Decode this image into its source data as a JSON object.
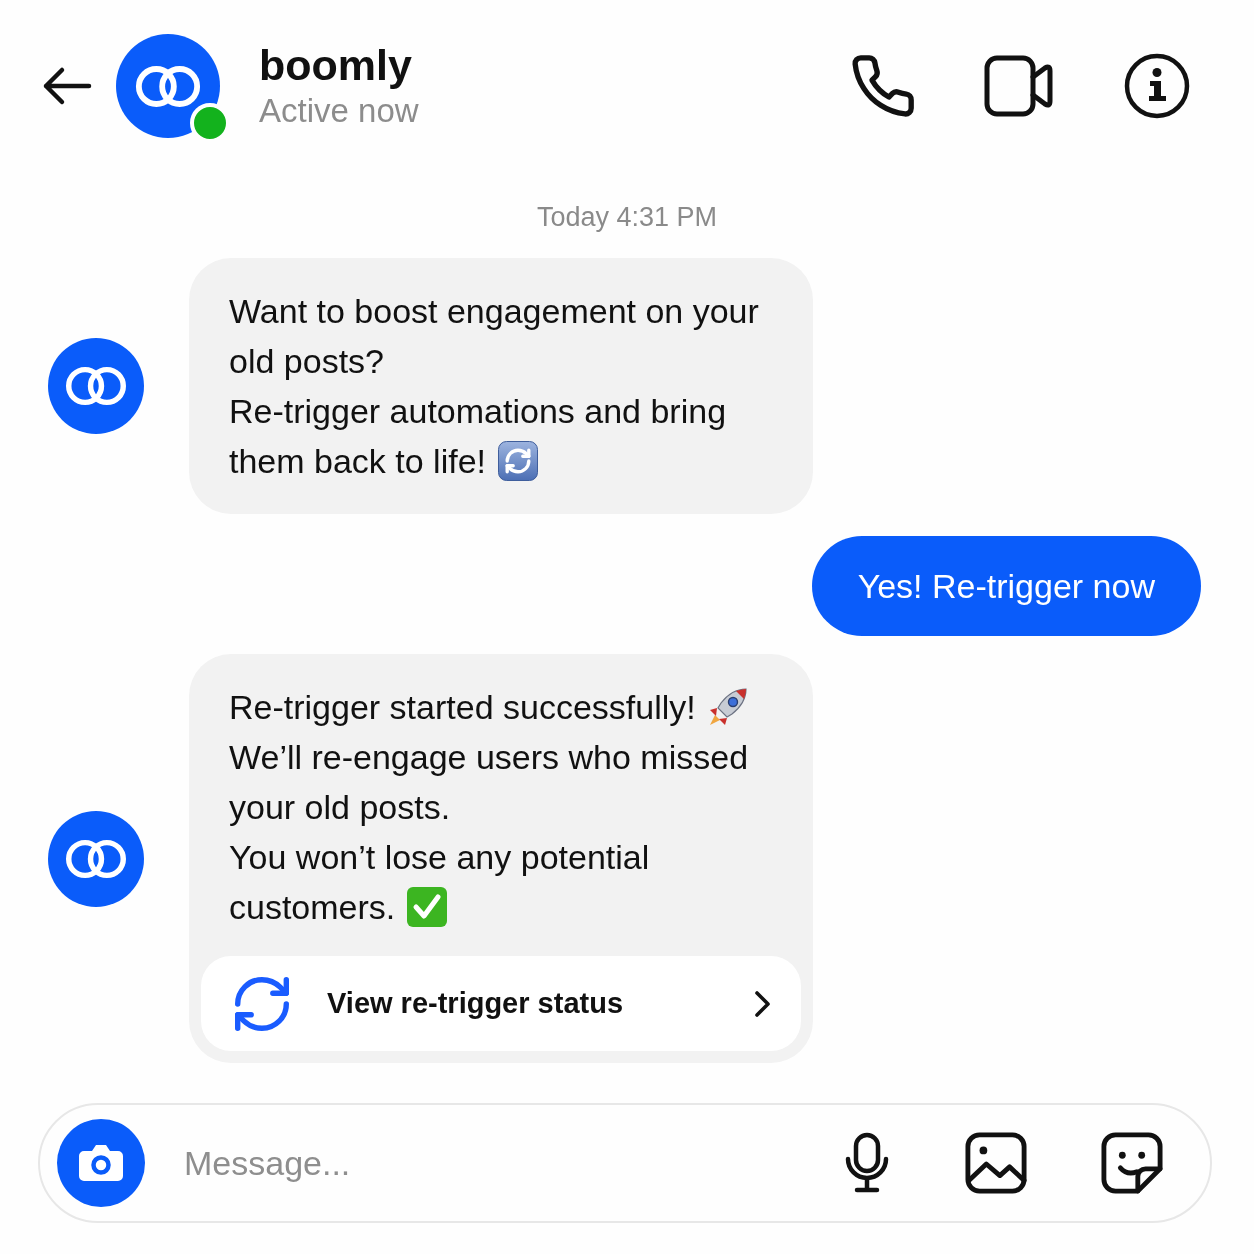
{
  "header": {
    "title": "boomly",
    "status": "Active now",
    "online": true
  },
  "timestamp": "Today 4:31 PM",
  "messages": [
    {
      "kind": "received",
      "paragraphs": [
        {
          "kind": "plain",
          "lines": [
            "Want to boost engagement on your",
            "old posts?"
          ]
        },
        {
          "kind": "refresh",
          "lines": [
            "Re-trigger automations and bring",
            "them back to life!"
          ]
        }
      ]
    },
    {
      "kind": "sent",
      "text": "Yes! Re-trigger now"
    },
    {
      "kind": "received",
      "paragraphs": [
        {
          "kind": "rocket",
          "lines": [
            "Re-trigger started successfully!"
          ]
        },
        {
          "kind": "plain",
          "lines": [
            "We’ll re-engage users who missed",
            "your old posts."
          ]
        },
        {
          "kind": "check",
          "lines": [
            "You won’t lose any potential",
            "customers."
          ]
        }
      ],
      "action": {
        "label": "View re-trigger status"
      }
    }
  ],
  "composer": {
    "placeholder": "Message..."
  }
}
